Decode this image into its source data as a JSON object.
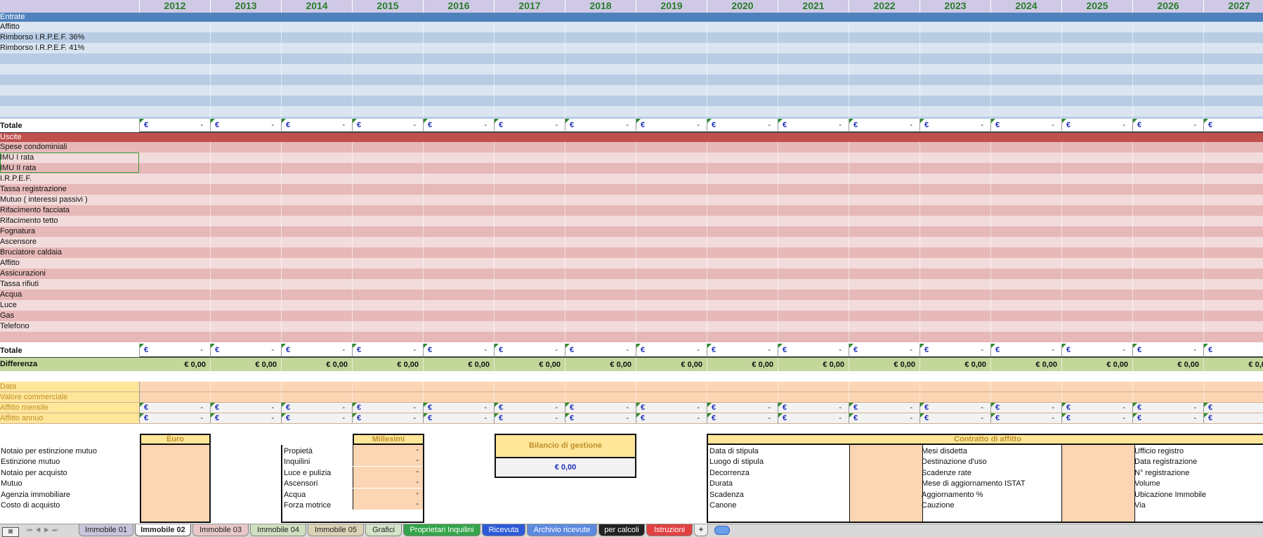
{
  "years": [
    "2012",
    "2013",
    "2014",
    "2015",
    "2016",
    "2017",
    "2018",
    "2019",
    "2020",
    "2021",
    "2022",
    "2023",
    "2024",
    "2025",
    "2026",
    "2027"
  ],
  "entrate": {
    "header": "Entrate",
    "items": [
      "Affitto",
      "Rimborso I.R.P.E.F. 36%",
      "Rimborso I.R.P.E.F. 41%",
      "",
      "",
      "",
      "",
      "",
      "",
      ""
    ]
  },
  "uscite": {
    "header": "Uscite",
    "items": [
      "Spese condominiali",
      "IMU I rata",
      "IMU II rata",
      "I.R.P.E.F.",
      "Tassa registrazione",
      "Mutuo ( interessi passivi )",
      "Rifacimento facciata",
      "Rifacimento tetto",
      "Fognatura",
      "Ascensore",
      "Bruciatore caldaia",
      "Affitto",
      "Assicurazioni",
      "Tassa rifiuti",
      "Acqua",
      "Luce",
      "Gas",
      "Telefono",
      ""
    ]
  },
  "totale_label": "Totale",
  "euro_symbol": "€",
  "dash": "-",
  "differenza": {
    "label": "Differenza",
    "value": "€ 0,00"
  },
  "extra_rows": [
    "Data",
    "Valore commerciale",
    "Affitto mensile",
    "Affitto annuo"
  ],
  "acquisto": {
    "header": "Euro",
    "items": [
      "Notaio per estinzione mutuo",
      "Estinzione mutuo",
      "Notaio per acquisto",
      "Mutuo",
      "Agenzia immobiliare",
      "Costo di acquisto"
    ]
  },
  "millesimi": {
    "header": "Millesimi",
    "items": [
      "Propietà",
      "Inquilini",
      "Luce e pulizia",
      "Ascensori",
      "Acqua",
      "Forza motrice"
    ]
  },
  "bilancio": {
    "title": "Bilancio di gestione",
    "value": "€ 0,00"
  },
  "contratto": {
    "title": "Contratto di affitto",
    "col1": [
      "Data di stipula",
      "Luogo di stipula",
      "Decorrenza",
      "Durata",
      "Scadenza",
      "Canone"
    ],
    "col2": [
      "Mesi disdetta",
      "Destinazione d'uso",
      "Scadenze rate",
      "Mese di aggiornamento ISTAT",
      "Aggiornamento %",
      "Cauzione"
    ],
    "col3": [
      "Ufficio registro",
      "Data registrazione",
      "N° registrazione",
      "Volume",
      "Ubicazione Immobile",
      "Via"
    ]
  },
  "tabs": [
    {
      "label": "Immobile 01",
      "bg": "#c9c3dc",
      "color": "#222"
    },
    {
      "label": "Immobile 02",
      "bg": "#ffffff",
      "color": "#222",
      "active": true
    },
    {
      "label": "Immobile 03",
      "bg": "#e8c7c7",
      "color": "#222"
    },
    {
      "label": "Immobile 04",
      "bg": "#cfe0c0",
      "color": "#222"
    },
    {
      "label": "Immobile 05",
      "bg": "#dcd3b6",
      "color": "#222"
    },
    {
      "label": "Grafici",
      "bg": "#d4e4c8",
      "color": "#222"
    },
    {
      "label": "Proprietari Inquilini",
      "bg": "#34a34a",
      "color": "#fff"
    },
    {
      "label": "Ricevuta",
      "bg": "#2d59d8",
      "color": "#fff"
    },
    {
      "label": "Archivio ricevute",
      "bg": "#5d8ae0",
      "color": "#fff"
    },
    {
      "label": "per calcoli",
      "bg": "#222222",
      "color": "#fff"
    },
    {
      "label": "Istruzioni",
      "bg": "#e04040",
      "color": "#fff"
    }
  ],
  "add_tab": "+",
  "colors": {
    "year_header": "#cfc9e6",
    "entrate_header": "#4f81bd",
    "entrate_a": "#dbe5f1",
    "entrate_b": "#b8cce4",
    "uscite_header": "#c0504d",
    "uscite_a": "#f2dcdb",
    "uscite_b": "#e6b8b7",
    "differenza": "#c4d79b",
    "orange": "#fcd5b4",
    "yellow_label": "#ffe699",
    "label_gold": "#c0902a"
  }
}
